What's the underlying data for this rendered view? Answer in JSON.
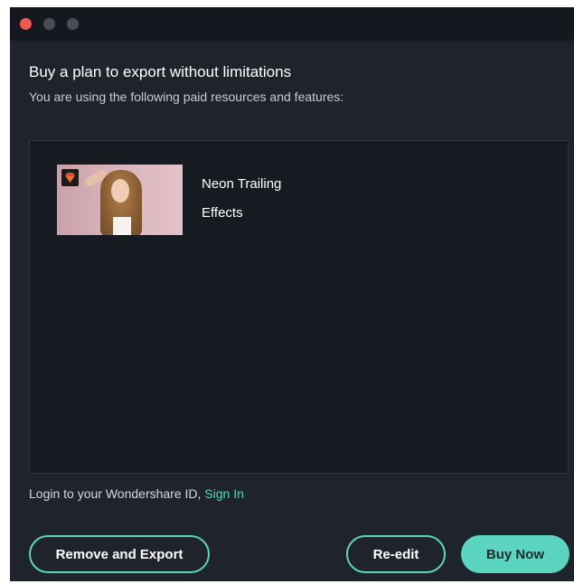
{
  "dialog": {
    "title": "Buy a plan to export without limitations",
    "subtitle": "You are using the following paid resources and features:"
  },
  "resources": [
    {
      "name": "Neon Trailing",
      "type": "Effects",
      "badge_icon": "premium-diamond-icon"
    }
  ],
  "login": {
    "text": "Login to your Wondershare ID, ",
    "link": "Sign In"
  },
  "buttons": {
    "remove_export": "Remove and Export",
    "re_edit": "Re-edit",
    "buy_now": "Buy Now"
  },
  "colors": {
    "accent": "#5bd4c0",
    "background": "#1f232b",
    "titlebar": "#15191f",
    "close": "#ee5a52",
    "premium": "#e8542a"
  }
}
